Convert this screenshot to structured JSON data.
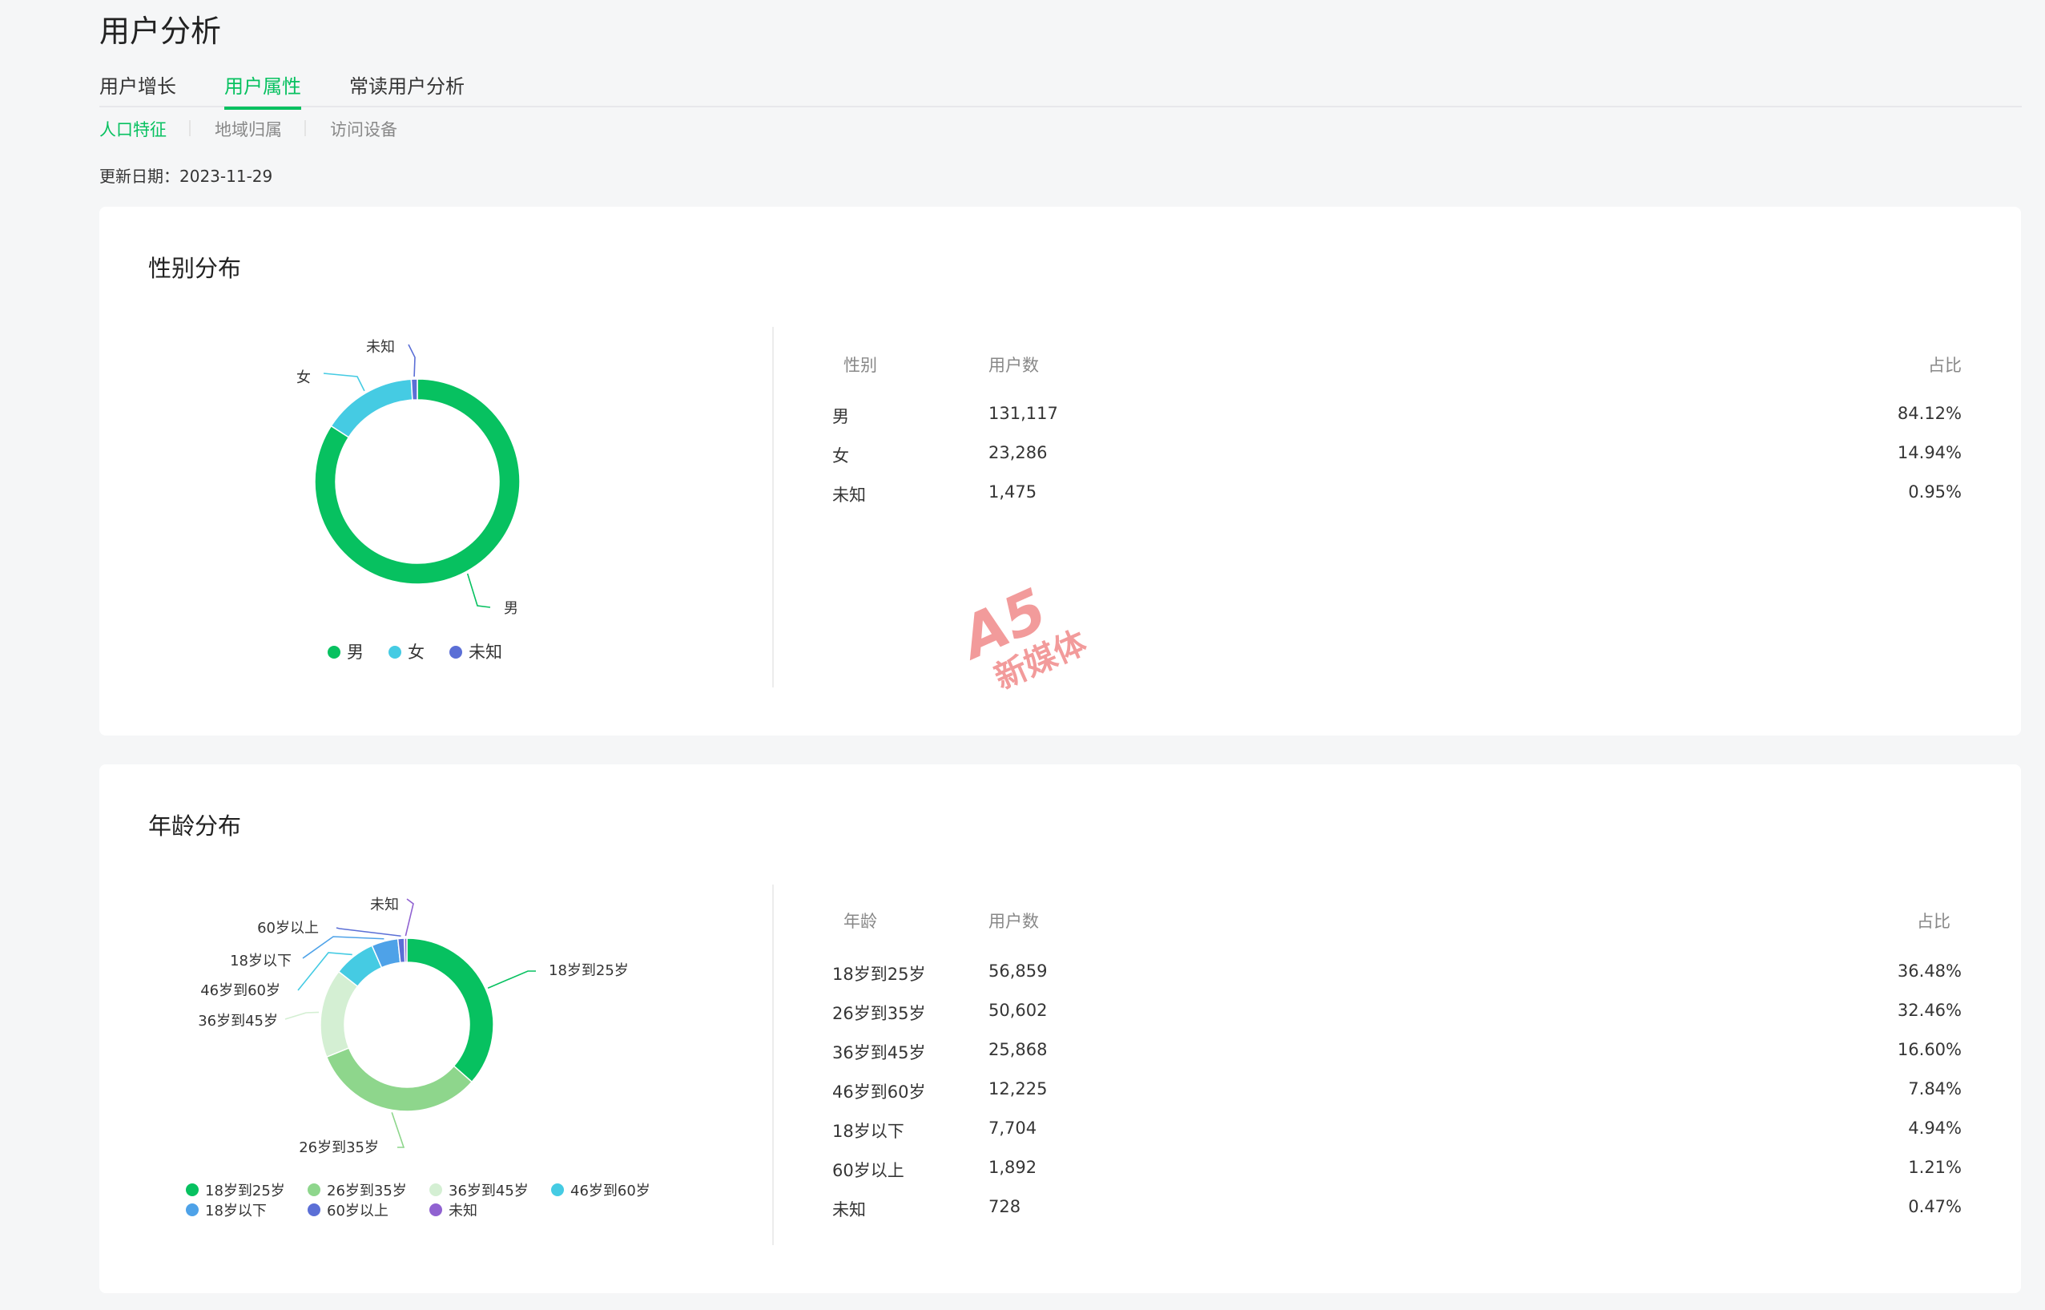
{
  "page": {
    "title": "用户分析"
  },
  "tabs": [
    {
      "label": "用户增长",
      "active": false
    },
    {
      "label": "用户属性",
      "active": true
    },
    {
      "label": "常读用户分析",
      "active": false
    }
  ],
  "subtabs": [
    {
      "label": "人口特征",
      "active": true
    },
    {
      "label": "地域归属",
      "active": false
    },
    {
      "label": "访问设备",
      "active": false
    }
  ],
  "update": {
    "label": "更新日期：",
    "date": "2023-11-29"
  },
  "watermark": {
    "line1": "A5",
    "line2": "新媒体"
  },
  "gender": {
    "title": "性别分布",
    "headers": {
      "category": "性别",
      "users": "用户数",
      "ratio": "占比"
    },
    "rows": [
      {
        "name": "男",
        "users": "131,117",
        "ratio": "84.12%"
      },
      {
        "name": "女",
        "users": "23,286",
        "ratio": "14.94%"
      },
      {
        "name": "未知",
        "users": "1,475",
        "ratio": "0.95%"
      }
    ],
    "legend": [
      "男",
      "女",
      "未知"
    ]
  },
  "age": {
    "title": "年龄分布",
    "headers": {
      "category": "年龄",
      "users": "用户数",
      "ratio": "占比"
    },
    "rows": [
      {
        "name": "18岁到25岁",
        "users": "56,859",
        "ratio": "36.48%"
      },
      {
        "name": "26岁到35岁",
        "users": "50,602",
        "ratio": "32.46%"
      },
      {
        "name": "36岁到45岁",
        "users": "25,868",
        "ratio": "16.60%"
      },
      {
        "name": "46岁到60岁",
        "users": "12,225",
        "ratio": "7.84%"
      },
      {
        "name": "18岁以下",
        "users": "7,704",
        "ratio": "4.94%"
      },
      {
        "name": "60岁以上",
        "users": "1,892",
        "ratio": "1.21%"
      },
      {
        "name": "未知",
        "users": "728",
        "ratio": "0.47%"
      }
    ],
    "legend": [
      "18岁到25岁",
      "26岁到35岁",
      "36岁到45岁",
      "46岁到60岁",
      "18岁以下",
      "60岁以上",
      "未知"
    ]
  },
  "colors": {
    "accent": "#07c160",
    "gender": [
      "#07c160",
      "#45cbe3",
      "#5b6fd6"
    ],
    "age": [
      "#07c160",
      "#8ed68c",
      "#d4efd3",
      "#45cbe3",
      "#4ea2e8",
      "#5b6fd6",
      "#9062d1"
    ]
  },
  "chart_data": [
    {
      "type": "pie",
      "title": "性别分布",
      "categories": [
        "男",
        "女",
        "未知"
      ],
      "values": [
        131117,
        23286,
        1475
      ],
      "percent": [
        84.12,
        14.94,
        0.95
      ],
      "donut": true,
      "legend_position": "bottom"
    },
    {
      "type": "pie",
      "title": "年龄分布",
      "categories": [
        "18岁到25岁",
        "26岁到35岁",
        "36岁到45岁",
        "46岁到60岁",
        "18岁以下",
        "60岁以上",
        "未知"
      ],
      "values": [
        56859,
        50602,
        25868,
        12225,
        7704,
        1892,
        728
      ],
      "percent": [
        36.48,
        32.46,
        16.6,
        7.84,
        4.94,
        1.21,
        0.47
      ],
      "donut": true,
      "legend_position": "bottom"
    }
  ]
}
